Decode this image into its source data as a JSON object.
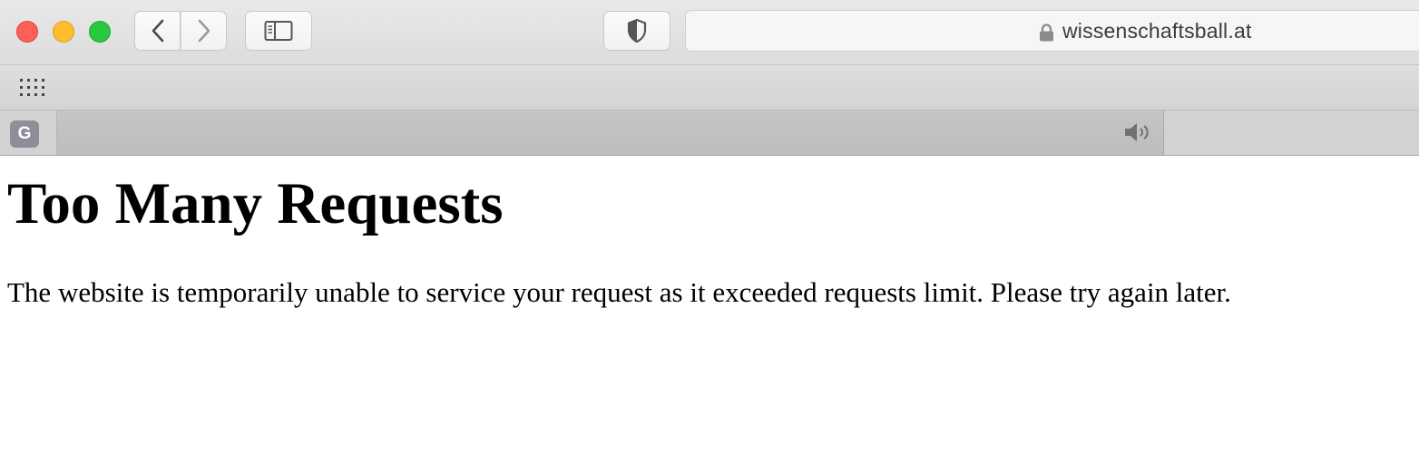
{
  "browser": {
    "address_url": "wissenschaftsball.at",
    "icons": {
      "back": "chevron-left-icon",
      "forward": "chevron-right-icon",
      "sidebar": "sidebar-icon",
      "shield": "shield-icon",
      "lock": "lock-icon",
      "favorites": "grid-icon",
      "tab_favicon": "G",
      "audio": "speaker-icon"
    }
  },
  "page": {
    "heading": "Too Many Requests",
    "message": "The website is temporarily unable to service your request as it exceeded requests limit. Please try again later."
  }
}
